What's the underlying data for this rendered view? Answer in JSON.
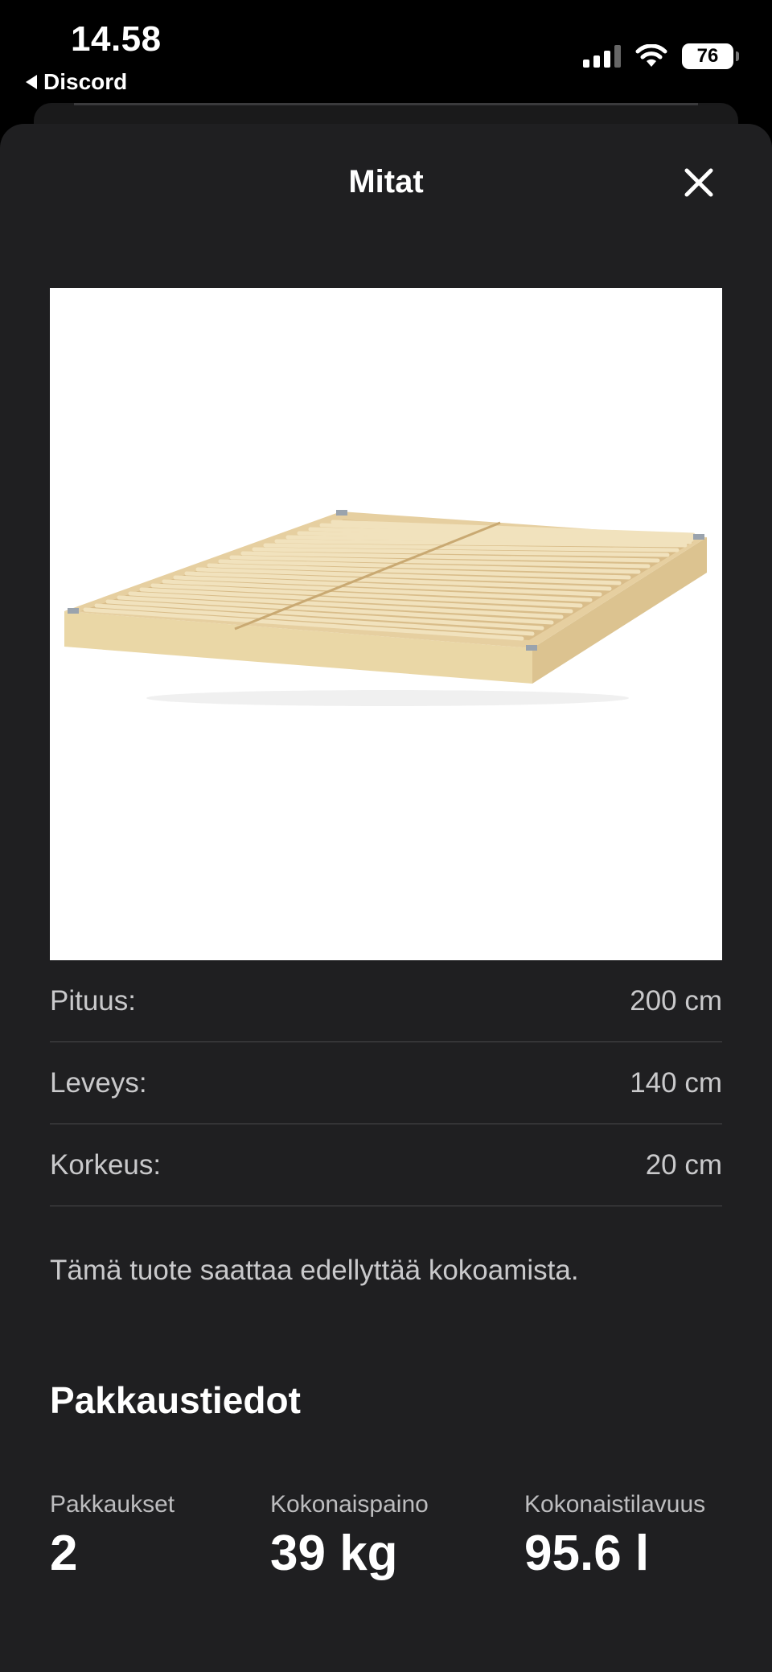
{
  "status_bar": {
    "time": "14.58",
    "back_app": "Discord",
    "battery": "76"
  },
  "sheet": {
    "title": "Mitat",
    "close_label": "Close"
  },
  "dimensions": [
    {
      "label": "Pituus:",
      "value": "200 cm"
    },
    {
      "label": "Leveys:",
      "value": "140 cm"
    },
    {
      "label": "Korkeus:",
      "value": "20 cm"
    }
  ],
  "note": "Tämä tuote saattaa edellyttää kokoamista.",
  "package": {
    "title": "Pakkaustiedot",
    "stats": [
      {
        "label": "Pakkaukset",
        "value": "2"
      },
      {
        "label": "Kokonaispaino",
        "value": "39 kg"
      },
      {
        "label": "Kokonaistilavuus",
        "value": "95.6 l"
      }
    ]
  }
}
